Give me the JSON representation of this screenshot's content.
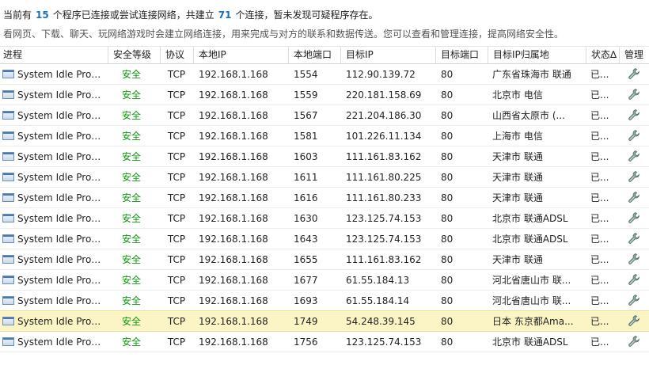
{
  "summary": {
    "prefix": "当前有",
    "program_count": "15",
    "mid": "个程序已连接或尝试连接网络，共建立",
    "connection_count": "71",
    "suffix": "个连接，暂未发现可疑程序存在。"
  },
  "hint": "看网页、下载、聊天、玩网络游戏时会建立网络连接，用来完成与对方的联系和数据传送。您可以查看和管理连接，提高网络安全性。",
  "columns": [
    "进程",
    "安全等级",
    "协议",
    "本地IP",
    "本地端口",
    "目标IP",
    "目标端口",
    "目标IP归属地",
    "状态∆",
    "管理"
  ],
  "icons": {
    "process": "window-icon",
    "manage": "wrench-icon"
  },
  "colors": {
    "safe": "#0a9a0a",
    "count": "#1a6fb5",
    "selected_row": "#fbf5c6"
  },
  "selected_index": 12,
  "rows": [
    {
      "process": "System Idle Process",
      "level": "安全",
      "protocol": "TCP",
      "local_ip": "192.168.1.168",
      "local_port": "1554",
      "remote_ip": "112.90.139.72",
      "remote_port": "80",
      "location": "广东省珠海市 联通",
      "status": "已..."
    },
    {
      "process": "System Idle Process",
      "level": "安全",
      "protocol": "TCP",
      "local_ip": "192.168.1.168",
      "local_port": "1559",
      "remote_ip": "220.181.158.69",
      "remote_port": "80",
      "location": "北京市 电信",
      "status": "已..."
    },
    {
      "process": "System Idle Process",
      "level": "安全",
      "protocol": "TCP",
      "local_ip": "192.168.1.168",
      "local_port": "1567",
      "remote_ip": "221.204.186.30",
      "remote_port": "80",
      "location": "山西省太原市 (...",
      "status": "已..."
    },
    {
      "process": "System Idle Process",
      "level": "安全",
      "protocol": "TCP",
      "local_ip": "192.168.1.168",
      "local_port": "1581",
      "remote_ip": "101.226.11.134",
      "remote_port": "80",
      "location": "上海市 电信",
      "status": "已..."
    },
    {
      "process": "System Idle Process",
      "level": "安全",
      "protocol": "TCP",
      "local_ip": "192.168.1.168",
      "local_port": "1603",
      "remote_ip": "111.161.83.162",
      "remote_port": "80",
      "location": "天津市 联通",
      "status": "已..."
    },
    {
      "process": "System Idle Process",
      "level": "安全",
      "protocol": "TCP",
      "local_ip": "192.168.1.168",
      "local_port": "1611",
      "remote_ip": "111.161.80.225",
      "remote_port": "80",
      "location": "天津市 联通",
      "status": "已..."
    },
    {
      "process": "System Idle Process",
      "level": "安全",
      "protocol": "TCP",
      "local_ip": "192.168.1.168",
      "local_port": "1616",
      "remote_ip": "111.161.80.233",
      "remote_port": "80",
      "location": "天津市 联通",
      "status": "已..."
    },
    {
      "process": "System Idle Process",
      "level": "安全",
      "protocol": "TCP",
      "local_ip": "192.168.1.168",
      "local_port": "1630",
      "remote_ip": "123.125.74.153",
      "remote_port": "80",
      "location": "北京市 联通ADSL",
      "status": "已..."
    },
    {
      "process": "System Idle Process",
      "level": "安全",
      "protocol": "TCP",
      "local_ip": "192.168.1.168",
      "local_port": "1643",
      "remote_ip": "123.125.74.153",
      "remote_port": "80",
      "location": "北京市 联通ADSL",
      "status": "已..."
    },
    {
      "process": "System Idle Process",
      "level": "安全",
      "protocol": "TCP",
      "local_ip": "192.168.1.168",
      "local_port": "1655",
      "remote_ip": "111.161.83.162",
      "remote_port": "80",
      "location": "天津市 联通",
      "status": "已..."
    },
    {
      "process": "System Idle Process",
      "level": "安全",
      "protocol": "TCP",
      "local_ip": "192.168.1.168",
      "local_port": "1677",
      "remote_ip": "61.55.184.13",
      "remote_port": "80",
      "location": "河北省唐山市 联...",
      "status": "已..."
    },
    {
      "process": "System Idle Process",
      "level": "安全",
      "protocol": "TCP",
      "local_ip": "192.168.1.168",
      "local_port": "1693",
      "remote_ip": "61.55.184.14",
      "remote_port": "80",
      "location": "河北省唐山市 联...",
      "status": "已..."
    },
    {
      "process": "System Idle Process",
      "level": "安全",
      "protocol": "TCP",
      "local_ip": "192.168.1.168",
      "local_port": "1749",
      "remote_ip": "54.248.39.145",
      "remote_port": "80",
      "location": "日本 东京都Ama...",
      "status": "已..."
    },
    {
      "process": "System Idle Process",
      "level": "安全",
      "protocol": "TCP",
      "local_ip": "192.168.1.168",
      "local_port": "1756",
      "remote_ip": "123.125.74.153",
      "remote_port": "80",
      "location": "北京市 联通ADSL",
      "status": "已..."
    }
  ]
}
